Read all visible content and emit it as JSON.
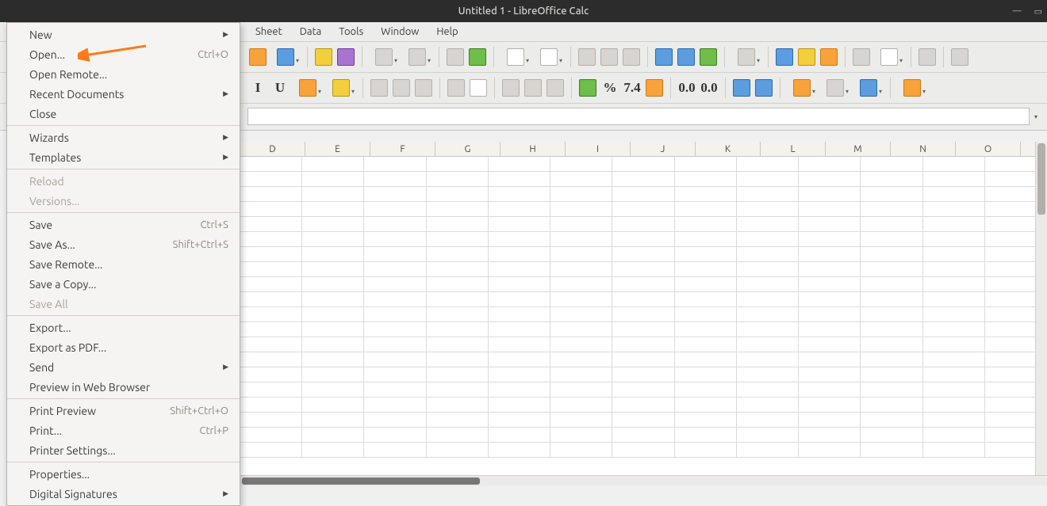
{
  "window": {
    "title": "Untitled 1 - LibreOffice Calc"
  },
  "menubar": {
    "items": [
      "Sheet",
      "Data",
      "Tools",
      "Window",
      "Help"
    ]
  },
  "file_menu": {
    "groups": [
      [
        {
          "label": "New",
          "sub": true
        },
        {
          "label": "Open...",
          "accel": "Ctrl+O",
          "highlight": true
        },
        {
          "label": "Open Remote..."
        },
        {
          "label": "Recent Documents",
          "sub": true
        },
        {
          "label": "Close"
        }
      ],
      [
        {
          "label": "Wizards",
          "sub": true
        },
        {
          "label": "Templates",
          "sub": true
        }
      ],
      [
        {
          "label": "Reload",
          "disabled": true
        },
        {
          "label": "Versions...",
          "disabled": true
        }
      ],
      [
        {
          "label": "Save",
          "accel": "Ctrl+S"
        },
        {
          "label": "Save As...",
          "accel": "Shift+Ctrl+S"
        },
        {
          "label": "Save Remote..."
        },
        {
          "label": "Save a Copy..."
        },
        {
          "label": "Save All",
          "disabled": true
        }
      ],
      [
        {
          "label": "Export..."
        },
        {
          "label": "Export as PDF..."
        },
        {
          "label": "Send",
          "sub": true
        },
        {
          "label": "Preview in Web Browser"
        }
      ],
      [
        {
          "label": "Print Preview",
          "accel": "Shift+Ctrl+O"
        },
        {
          "label": "Print...",
          "accel": "Ctrl+P"
        },
        {
          "label": "Printer Settings..."
        }
      ],
      [
        {
          "label": "Properties..."
        },
        {
          "label": "Digital Signatures",
          "sub": true
        }
      ]
    ]
  },
  "columns": [
    "D",
    "E",
    "F",
    "G",
    "H",
    "I",
    "J",
    "K",
    "L",
    "M",
    "N",
    "O"
  ],
  "toolbar1": [
    {
      "name": "export-pdf",
      "cls": "ic-orange"
    },
    {
      "name": "print-direct",
      "cls": "ic-blue",
      "split": true
    },
    null,
    {
      "name": "clone-formatting",
      "cls": "ic-yellow"
    },
    {
      "name": "clear-formatting",
      "cls": "ic-purple"
    },
    null,
    {
      "name": "undo",
      "cls": "",
      "split": true
    },
    {
      "name": "redo",
      "cls": "",
      "split": true
    },
    null,
    {
      "name": "find-replace",
      "cls": ""
    },
    {
      "name": "spelling",
      "cls": "ic-green"
    },
    null,
    {
      "name": "row",
      "cls": "ic-grid",
      "split": true
    },
    {
      "name": "column",
      "cls": "ic-grid",
      "split": true
    },
    null,
    {
      "name": "sort-asc",
      "cls": ""
    },
    {
      "name": "sort-desc",
      "cls": ""
    },
    {
      "name": "autofilter",
      "cls": ""
    },
    null,
    {
      "name": "image",
      "cls": "ic-blue"
    },
    {
      "name": "chart",
      "cls": "ic-blue"
    },
    {
      "name": "pivot",
      "cls": "ic-green"
    },
    null,
    {
      "name": "special-char",
      "cls": "",
      "split": true
    },
    null,
    {
      "name": "hyperlink",
      "cls": "ic-blue"
    },
    {
      "name": "comment",
      "cls": "ic-yellow"
    },
    {
      "name": "headers-footers",
      "cls": "ic-orange"
    },
    null,
    {
      "name": "print-btn",
      "cls": ""
    },
    {
      "name": "freeze",
      "cls": "ic-grid",
      "split": true
    },
    null,
    {
      "name": "split-window",
      "cls": ""
    },
    null,
    {
      "name": "draw-functions",
      "cls": ""
    }
  ],
  "toolbar2": [
    {
      "name": "italic",
      "txt": "I",
      "title": "Italic"
    },
    {
      "name": "underline",
      "txt": "U",
      "title": "Underline"
    },
    {
      "name": "font-color",
      "cls": "ic-orange",
      "split": true
    },
    {
      "name": "highlight",
      "cls": "ic-yellow",
      "split": true
    },
    null,
    {
      "name": "align-left",
      "cls": ""
    },
    {
      "name": "align-center",
      "cls": ""
    },
    {
      "name": "align-right",
      "cls": ""
    },
    null,
    {
      "name": "wrap",
      "cls": ""
    },
    {
      "name": "merge",
      "cls": "ic-grid"
    },
    null,
    {
      "name": "align-top",
      "cls": ""
    },
    {
      "name": "align-mid",
      "cls": ""
    },
    {
      "name": "align-bot",
      "cls": ""
    },
    null,
    {
      "name": "currency",
      "cls": "ic-green"
    },
    {
      "name": "percent",
      "txt": "%"
    },
    {
      "name": "number",
      "txt": "7.4"
    },
    {
      "name": "date",
      "cls": "ic-orange"
    },
    null,
    {
      "name": "add-decimal",
      "txt": "0.0"
    },
    {
      "name": "del-decimal",
      "txt": "0.0"
    },
    null,
    {
      "name": "inc-indent",
      "cls": "ic-blue"
    },
    {
      "name": "dec-indent",
      "cls": "ic-blue"
    },
    null,
    {
      "name": "borders",
      "cls": "ic-orange",
      "split": true
    },
    {
      "name": "border-style",
      "cls": "",
      "split": true
    },
    {
      "name": "border-color",
      "cls": "ic-blue",
      "split": true
    },
    null,
    {
      "name": "cond-format",
      "cls": "ic-orange",
      "split": true
    }
  ]
}
